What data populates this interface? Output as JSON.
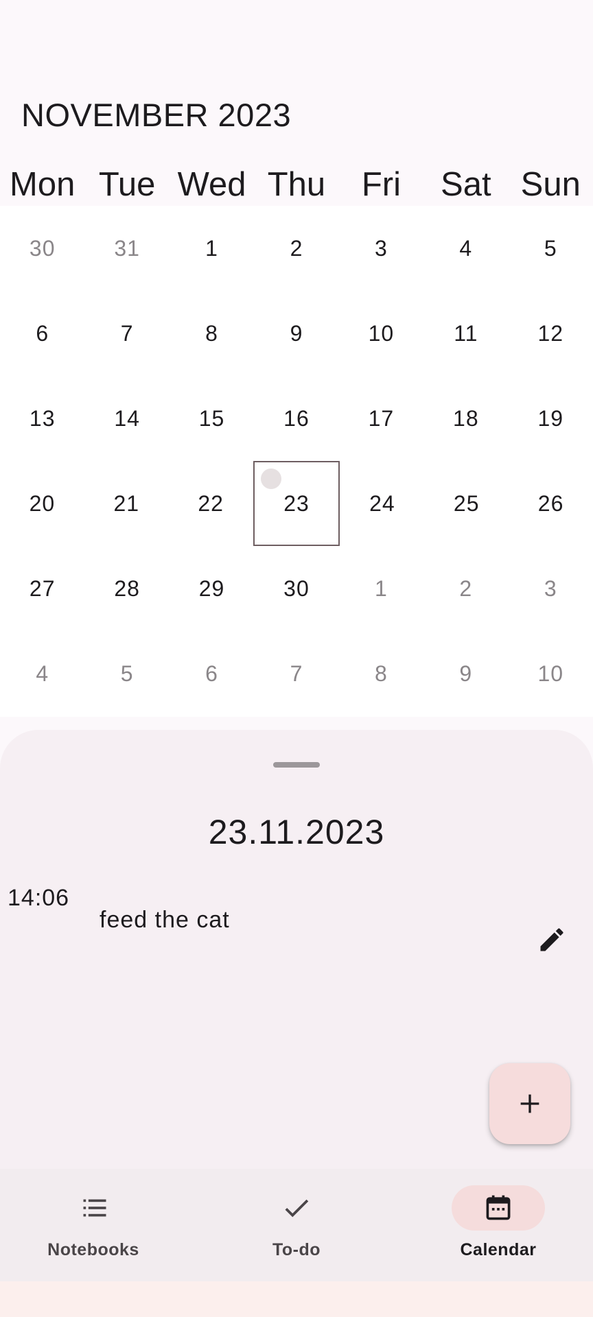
{
  "header": {
    "month_title": "NOVEMBER 2023",
    "weekdays": [
      "Mon",
      "Tue",
      "Wed",
      "Thu",
      "Fri",
      "Sat",
      "Sun"
    ]
  },
  "calendar": {
    "weeks": [
      [
        {
          "d": "30",
          "muted": true
        },
        {
          "d": "31",
          "muted": true
        },
        {
          "d": "1"
        },
        {
          "d": "2"
        },
        {
          "d": "3"
        },
        {
          "d": "4"
        },
        {
          "d": "5"
        }
      ],
      [
        {
          "d": "6"
        },
        {
          "d": "7"
        },
        {
          "d": "8"
        },
        {
          "d": "9"
        },
        {
          "d": "10"
        },
        {
          "d": "11"
        },
        {
          "d": "12"
        }
      ],
      [
        {
          "d": "13"
        },
        {
          "d": "14"
        },
        {
          "d": "15"
        },
        {
          "d": "16"
        },
        {
          "d": "17"
        },
        {
          "d": "18"
        },
        {
          "d": "19"
        }
      ],
      [
        {
          "d": "20"
        },
        {
          "d": "21"
        },
        {
          "d": "22"
        },
        {
          "d": "23",
          "selected": true,
          "event": true
        },
        {
          "d": "24"
        },
        {
          "d": "25"
        },
        {
          "d": "26"
        }
      ],
      [
        {
          "d": "27"
        },
        {
          "d": "28"
        },
        {
          "d": "29"
        },
        {
          "d": "30"
        },
        {
          "d": "1",
          "muted": true
        },
        {
          "d": "2",
          "muted": true
        },
        {
          "d": "3",
          "muted": true
        }
      ],
      [
        {
          "d": "4",
          "muted": true
        },
        {
          "d": "5",
          "muted": true
        },
        {
          "d": "6",
          "muted": true
        },
        {
          "d": "7",
          "muted": true
        },
        {
          "d": "8",
          "muted": true
        },
        {
          "d": "9",
          "muted": true
        },
        {
          "d": "10",
          "muted": true
        }
      ]
    ]
  },
  "sheet": {
    "date": "23.11.2023",
    "entry": {
      "time": "14:06",
      "text": "feed the cat",
      "edit_icon": "pencil-icon"
    },
    "fab_icon": "plus-icon"
  },
  "nav": {
    "items": [
      {
        "label": "Notebooks",
        "icon": "list-icon",
        "active": false
      },
      {
        "label": "To-do",
        "icon": "check-icon",
        "active": false
      },
      {
        "label": "Calendar",
        "icon": "calendar-icon",
        "active": true
      }
    ]
  },
  "colors": {
    "background": "#fcf8fb",
    "sheet": "#f6eff3",
    "fab": "#f6dcdc",
    "nav_active_pill": "#f5dcdc",
    "selected_border": "#6e5e61"
  }
}
